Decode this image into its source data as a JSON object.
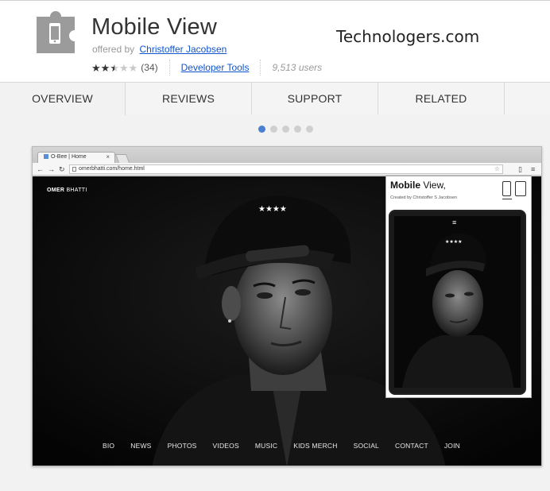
{
  "extension": {
    "title": "Mobile View",
    "offered_by_prefix": "offered by",
    "author": "Christoffer Jacobsen",
    "rating_stars": 2.5,
    "rating_count": "(34)",
    "category": "Developer Tools",
    "users": "9,513 users"
  },
  "watermark": "Technologers.com",
  "tabs": [
    {
      "label": "OVERVIEW",
      "active": true
    },
    {
      "label": "REVIEWS",
      "active": false
    },
    {
      "label": "SUPPORT",
      "active": false
    },
    {
      "label": "RELATED",
      "active": false
    }
  ],
  "carousel": {
    "total": 5,
    "active_index": 1
  },
  "screenshot": {
    "browser_tab_title": "O-Bee | Home",
    "url": "omerbhatti.com/home.html",
    "site": {
      "brand_first": "OMER",
      "brand_last": "BHATTI",
      "nav": [
        "BIO",
        "NEWS",
        "PHOTOS",
        "VIDEOS",
        "MUSIC",
        "KIDS MERCH",
        "SOCIAL",
        "CONTACT",
        "JOIN"
      ]
    },
    "popup": {
      "title_strong": "Mobile",
      "title_rest": "View,",
      "credit": "Created by Christoffer S Jacobsen"
    }
  }
}
